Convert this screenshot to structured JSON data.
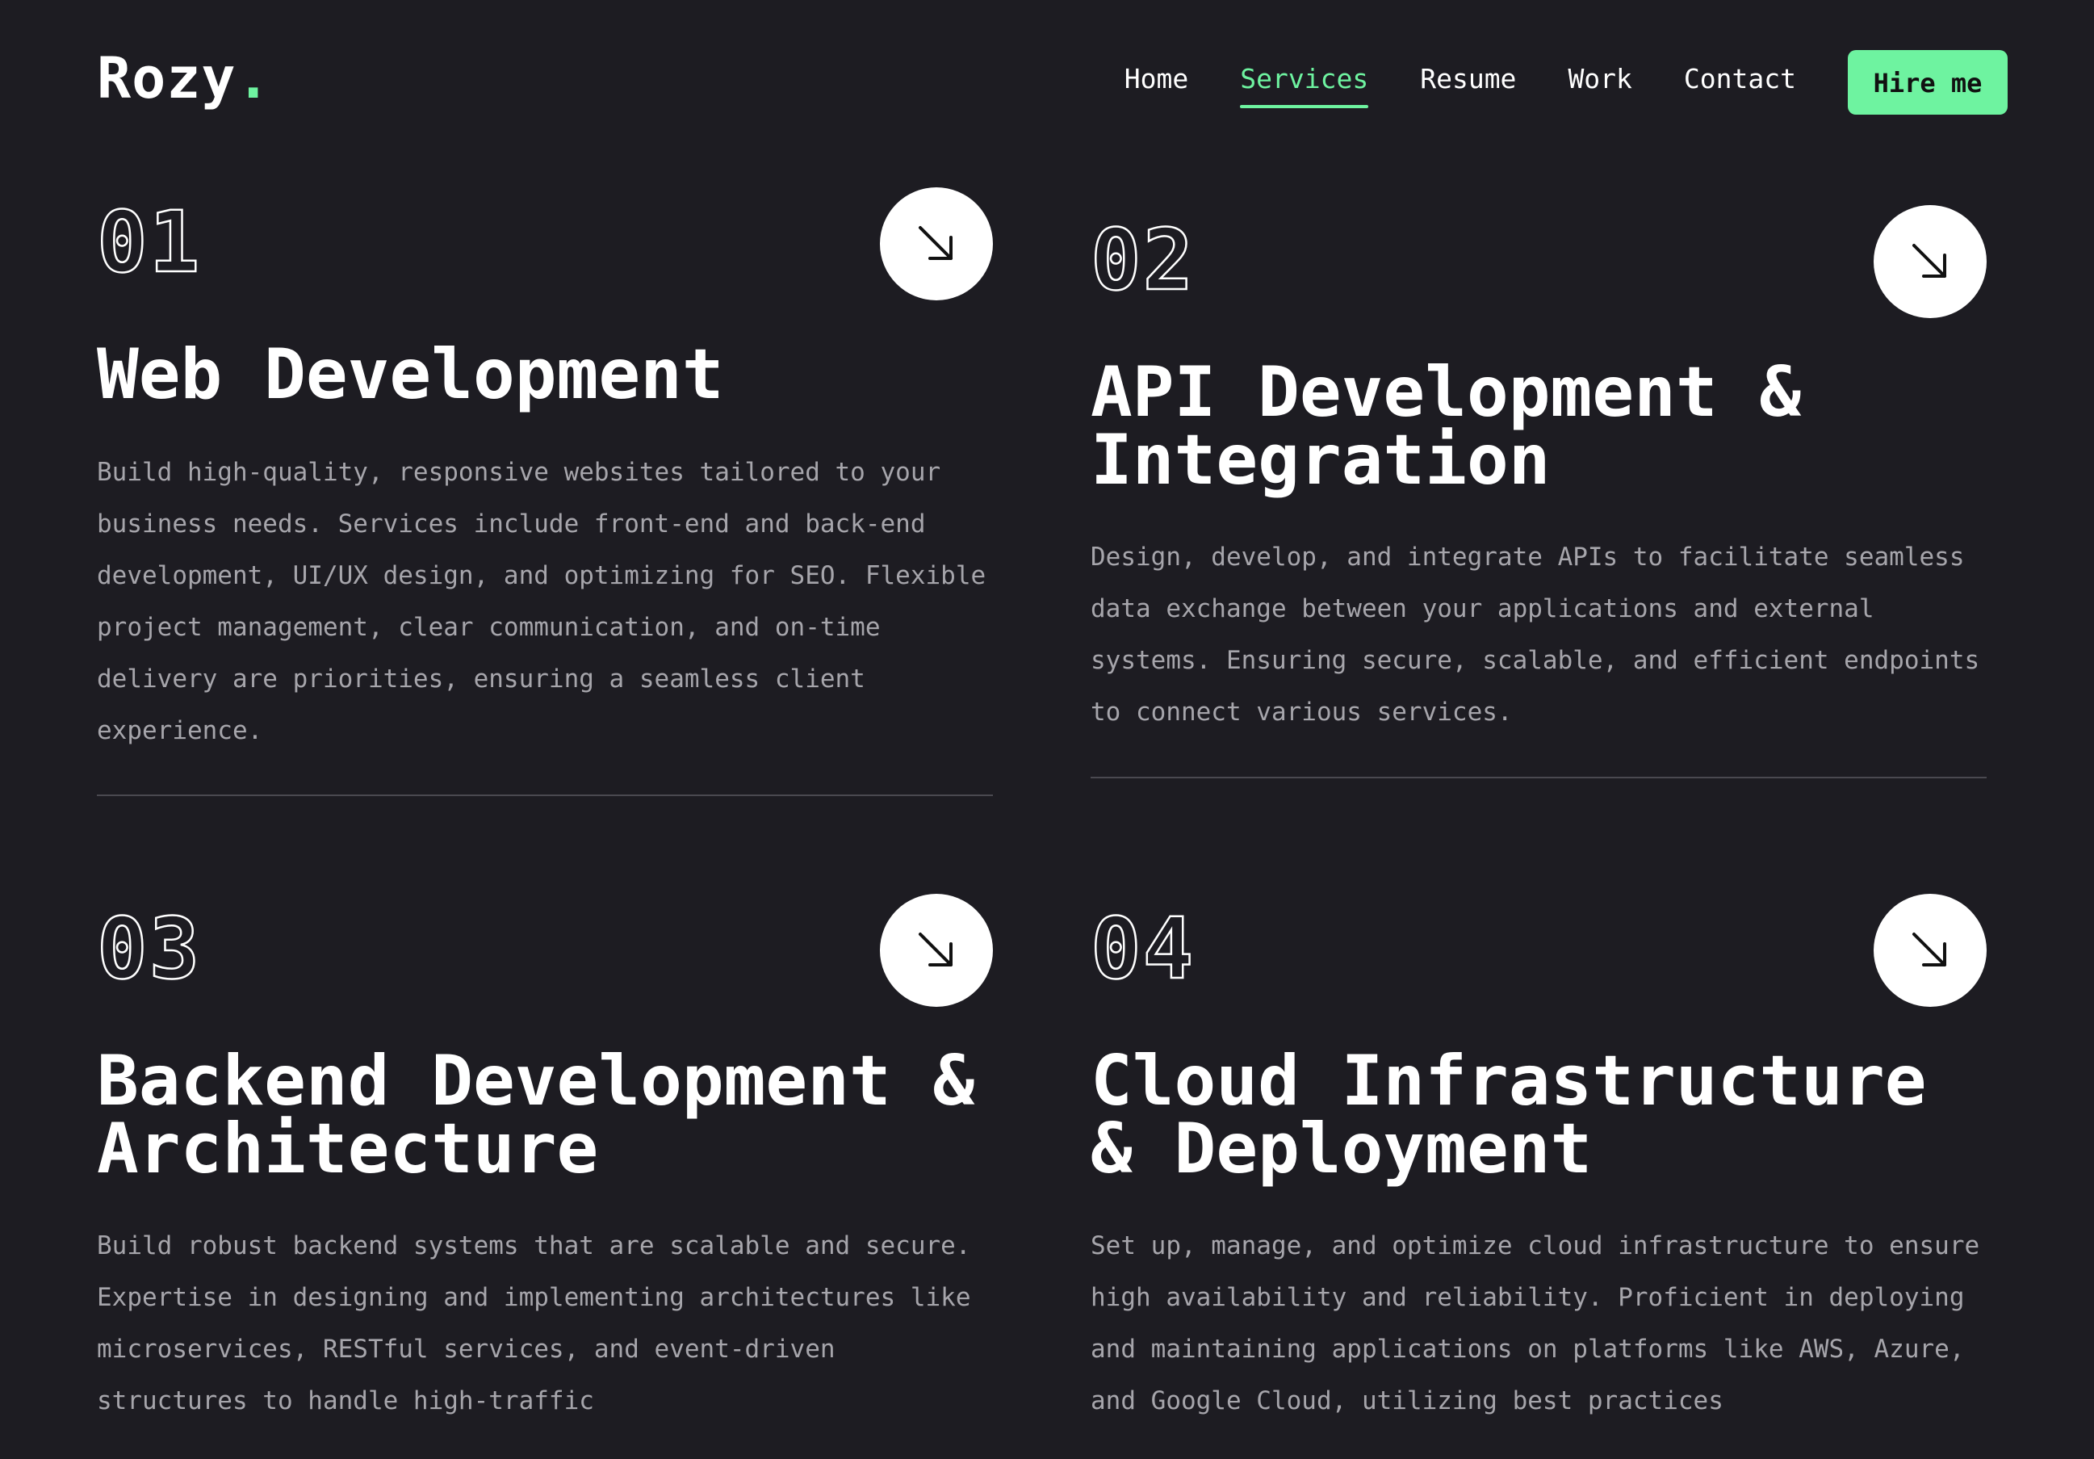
{
  "header": {
    "logo_text": "Rozy",
    "logo_dot": ".",
    "nav": [
      {
        "label": "Home"
      },
      {
        "label": "Services"
      },
      {
        "label": "Resume"
      },
      {
        "label": "Work"
      },
      {
        "label": "Contact"
      }
    ],
    "active_nav": "Services",
    "hire_label": "Hire me"
  },
  "services": [
    {
      "number": "01",
      "title": "Web Development",
      "description": "Build high-quality, responsive websites tailored to your business needs. Services include front-end and back-end development, UI/UX design, and optimizing for SEO. Flexible project management, clear communication, and on-time delivery are priorities, ensuring a seamless client experience."
    },
    {
      "number": "02",
      "title": "API Development & Integration",
      "description": "Design, develop, and integrate APIs to facilitate seamless data exchange between your applications and external systems. Ensuring secure, scalable, and efficient endpoints to connect various services."
    },
    {
      "number": "03",
      "title": "Backend Development & Architecture",
      "description": "Build robust backend systems that are scalable and secure. Expertise in designing and implementing architectures like microservices, RESTful services, and event-driven structures to handle high-traffic"
    },
    {
      "number": "04",
      "title": "Cloud Infrastructure & Deployment",
      "description": "Set up, manage, and optimize cloud infrastructure to ensure high availability and reliability. Proficient in deploying and maintaining applications on platforms like AWS, Azure, and Google Cloud, utilizing best practices"
    }
  ],
  "colors": {
    "background": "#1d1c22",
    "accent": "#6ef3a0",
    "text": "#ffffff",
    "muted": "#a6a5ab"
  },
  "icons": {
    "service_button": "arrow-down-right-icon"
  }
}
